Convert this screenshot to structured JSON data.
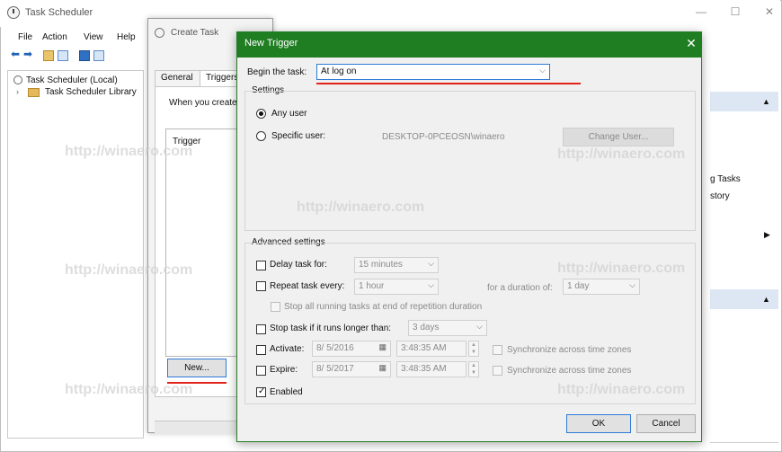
{
  "main_window": {
    "title": "Task Scheduler",
    "menu": [
      "File",
      "Action",
      "View",
      "Help"
    ],
    "tree": {
      "root": "Task Scheduler (Local)",
      "library": "Task Scheduler Library"
    },
    "right_pane": {
      "item1": "g Tasks",
      "item2": "story"
    },
    "window_controls": {
      "minimize": "—",
      "maximize": "☐",
      "close": "✕"
    }
  },
  "create_task": {
    "title": "Create Task",
    "tabs": [
      "General",
      "Triggers"
    ],
    "description": "When you create",
    "trigger_header": "Trigger",
    "new_button": "New..."
  },
  "new_trigger": {
    "title": "New Trigger",
    "close": "✕",
    "begin_label": "Begin the task:",
    "begin_value": "At log on",
    "settings_label": "Settings",
    "any_user": "Any user",
    "specific_user": "Specific user:",
    "user_value": "DESKTOP-0PCEOSN\\winaero",
    "change_user": "Change User...",
    "advanced_label": "Advanced settings",
    "delay_label": "Delay task for:",
    "delay_value": "15 minutes",
    "repeat_label": "Repeat task every:",
    "repeat_value": "1 hour",
    "duration_label": "for a duration of:",
    "duration_value": "1 day",
    "stop_all_label": "Stop all running tasks at end of repetition duration",
    "stop_longer_label": "Stop task if it runs longer than:",
    "stop_longer_value": "3 days",
    "activate_label": "Activate:",
    "activate_date": "8/ 5/2016",
    "activate_time": "3:48:35 AM",
    "expire_label": "Expire:",
    "expire_date": "8/ 5/2017",
    "expire_time": "3:48:35 AM",
    "sync_label": "Synchronize across time zones",
    "enabled_label": "Enabled",
    "ok": "OK",
    "cancel": "Cancel"
  },
  "watermark": "http://winaero.com",
  "colors": {
    "dialog_titlebar": "#1f7d22",
    "highlight_underline": "#e2231a",
    "selection_border": "#2c7ad6"
  }
}
